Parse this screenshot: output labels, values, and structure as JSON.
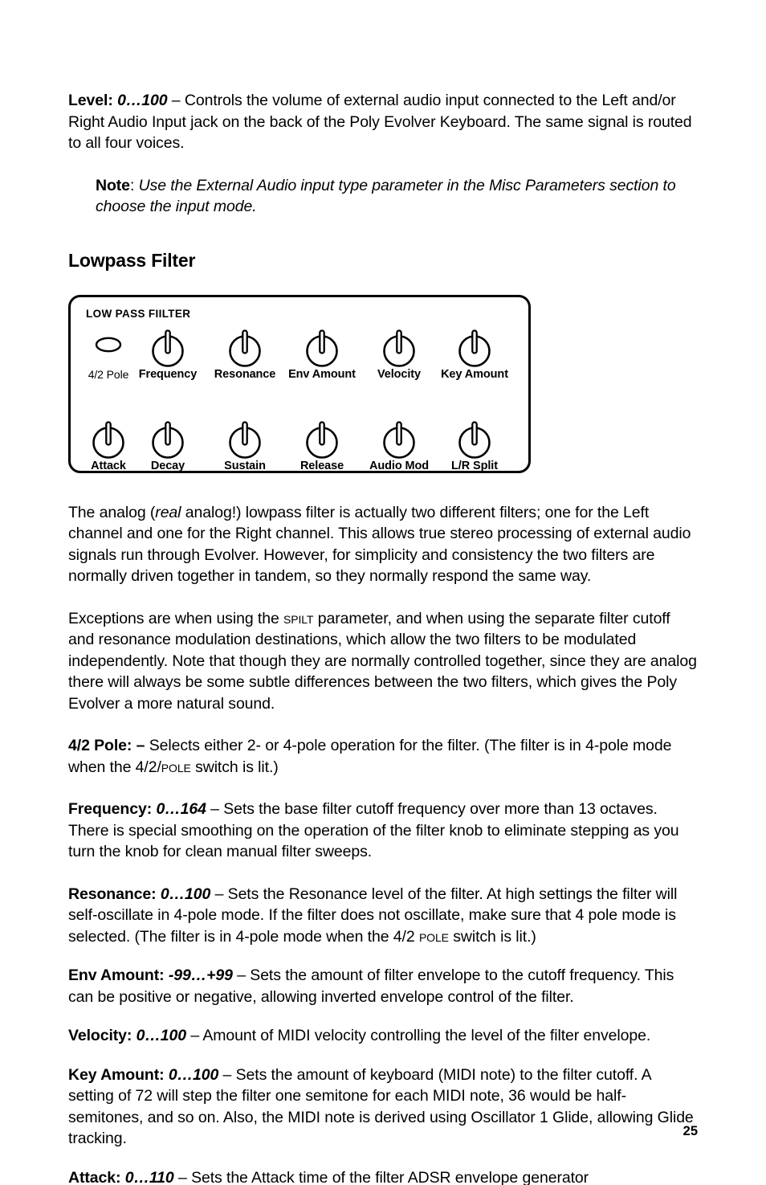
{
  "page": {
    "number": "25"
  },
  "sections": {
    "level": {
      "term": "Level:",
      "range": "0…100",
      "dash": " – ",
      "body": "Controls the volume of external audio input connected to the Left and/or Right Audio Input jack on the back of the Poly Evolver Keyboard. The same signal is routed to all four voices."
    },
    "note": {
      "label": "Note",
      "colon": ": ",
      "body": "Use the External Audio input type parameter in the Misc Parameters section to choose the input mode."
    },
    "heading": "Lowpass Filter",
    "intro": {
      "text_a": "The analog (",
      "emph": "real",
      "text_b": " analog!) lowpass filter is actually two different filters; one for the Left channel and one for the Right channel. This allows true stereo processing of external audio signals run through Evolver. However, for simplicity and consistency the two filters are normally driven together in tandem, so they normally respond the same way."
    },
    "exceptions": {
      "text_a": "Exceptions are when using the ",
      "smallcaps": "Spilt",
      "text_b": " parameter, and when using the separate filter cutoff and resonance modulation destinations, which allow the two filters to be modulated independently. Note that though they are normally controlled together, since they are analog there will always be some subtle differences between the two filters, which gives the Poly Evolver a more natural sound."
    },
    "pole": {
      "term": "4/2 Pole",
      "colon": ":",
      "dash": " – ",
      "text_a": "Selects either 2- or 4-pole operation for the filter. (The filter is in 4-pole mode when the 4/2/",
      "smallcaps": "Pole",
      "text_b": " switch is lit.)"
    },
    "frequency": {
      "term": "Frequency:",
      "range": "0…164",
      "dash": " – ",
      "body": "Sets the base filter cutoff frequency over more than 13 octaves. There is special smoothing on the operation of the filter knob to eliminate stepping as you turn the knob for clean manual filter sweeps."
    },
    "resonance": {
      "term": "Resonance:",
      "range": "0…100",
      "dash": " – ",
      "text_a": "Sets the Resonance level of the filter. At high settings the filter will self-oscillate in 4-pole mode. If the filter does not oscillate, make sure that 4 pole mode is selected. (The filter is in 4-pole mode when the 4/2 ",
      "smallcaps": "Pole",
      "text_b": " switch is lit.)"
    },
    "env_amount": {
      "term": "Env Amount:",
      "range": "-99…+99",
      "dash": " – ",
      "body": "Sets the amount of filter envelope to the cutoff frequency. This can be positive or negative, allowing inverted envelope control of the filter."
    },
    "velocity": {
      "term": "Velocity:",
      "range": "0…100",
      "dash": " – ",
      "body": "Amount of MIDI velocity controlling the level of the filter envelope."
    },
    "key_amount": {
      "term": "Key Amount:",
      "range": "0…100",
      "dash": " – ",
      "body": "Sets the amount of keyboard (MIDI note) to the filter cutoff. A setting of 72 will step the filter one semitone for each MIDI note, 36 would be half-semitones, and so on. Also, the MIDI note is derived using Oscillator 1 Glide, allowing Glide tracking."
    },
    "attack": {
      "term": "Attack:",
      "range": "0…110",
      "dash": " – ",
      "body": "Sets the Attack time of the filter ADSR envelope generator"
    }
  },
  "panel": {
    "title": "LOW PASS FIILTER",
    "controls": [
      {
        "label": "4/2 Pole",
        "type": "led",
        "row": 0,
        "col": 0
      },
      {
        "label": "Frequency",
        "type": "knob",
        "row": 0,
        "col": 1
      },
      {
        "label": "Resonance",
        "type": "knob",
        "row": 0,
        "col": 2
      },
      {
        "label": "Env Amount",
        "type": "knob",
        "row": 0,
        "col": 3
      },
      {
        "label": "Velocity",
        "type": "knob",
        "row": 0,
        "col": 4
      },
      {
        "label": "Key Amount",
        "type": "knob",
        "row": 0,
        "col": 5
      },
      {
        "label": "Attack",
        "type": "knob",
        "row": 1,
        "col": 0
      },
      {
        "label": "Decay",
        "type": "knob",
        "row": 1,
        "col": 1
      },
      {
        "label": "Sustain",
        "type": "knob",
        "row": 1,
        "col": 2
      },
      {
        "label": "Release",
        "type": "knob",
        "row": 1,
        "col": 3
      },
      {
        "label": "Audio Mod",
        "type": "knob",
        "row": 1,
        "col": 4
      },
      {
        "label": "L/R Split",
        "type": "knob",
        "row": 1,
        "col": 5
      }
    ]
  }
}
